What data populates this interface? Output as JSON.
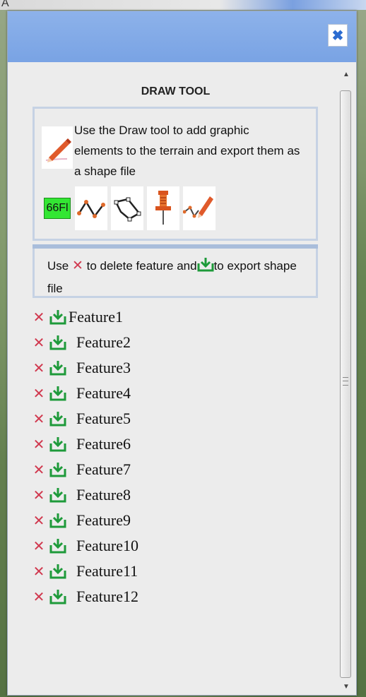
{
  "background": {
    "corner_char": "A"
  },
  "panel": {
    "close_label": "✖",
    "title": "DRAW TOOL",
    "intro_text": "Use the Draw tool to add graphic elements to the terrain and export them as a shape file",
    "tools": [
      {
        "name": "label-tool",
        "label": "66Fl",
        "icon": "text-label-icon"
      },
      {
        "name": "polyline-tool",
        "icon": "polyline-icon"
      },
      {
        "name": "polygon-tool",
        "icon": "polygon-icon"
      },
      {
        "name": "placemark-tool",
        "icon": "pushpin-icon"
      },
      {
        "name": "freehand-tool",
        "icon": "freehand-pencil-icon"
      }
    ],
    "help": {
      "part1": "Use ",
      "delete_symbol": "✕",
      "part2": " to delete feature and",
      "part3": "to export shape file"
    },
    "features": [
      {
        "name": "Feature1"
      },
      {
        "name": "Feature2"
      },
      {
        "name": "Feature3"
      },
      {
        "name": "Feature4"
      },
      {
        "name": "Feature5"
      },
      {
        "name": "Feature6"
      },
      {
        "name": "Feature7"
      },
      {
        "name": "Feature8"
      },
      {
        "name": "Feature9"
      },
      {
        "name": "Feature10"
      },
      {
        "name": "Feature11"
      },
      {
        "name": "Feature12"
      }
    ],
    "delete_symbol": "✕",
    "scroll_up": "▲",
    "scroll_down": "▼"
  },
  "colors": {
    "header": "#79a3e4",
    "delete": "#d0384e",
    "export": "#1e9a3a",
    "label_bg": "#33e633"
  }
}
